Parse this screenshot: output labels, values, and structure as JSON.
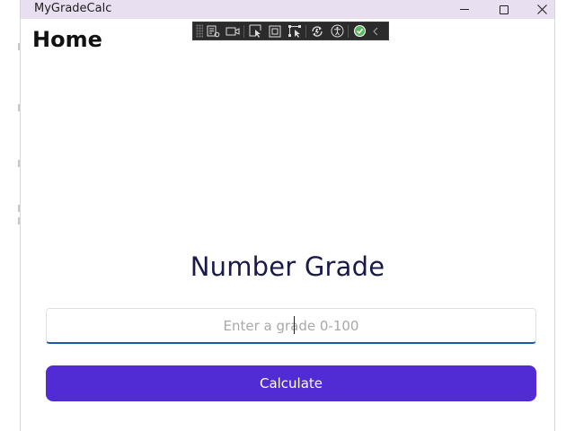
{
  "window": {
    "title": "MyGradeCalc",
    "titlebar_color": "#e8dff0",
    "controls": [
      "minimize-icon",
      "maximize-icon",
      "close-icon"
    ]
  },
  "debug_toolbar": {
    "icons": [
      "live-visual-tree-icon",
      "video-record-icon",
      "select-element-icon",
      "display-layout-adorners-icon",
      "track-focus-icon",
      "hot-reload-icon",
      "accessibility-checker-icon",
      "no-issues-check-icon",
      "collapse-chevron-icon"
    ]
  },
  "page": {
    "heading": "Home",
    "grade_title": "Number Grade",
    "grade_input": {
      "value": "",
      "placeholder": "Enter a grade 0-100"
    },
    "calculate_label": "Calculate",
    "button_color": "#512bd4",
    "input_underline_color": "#1b5aa8"
  }
}
